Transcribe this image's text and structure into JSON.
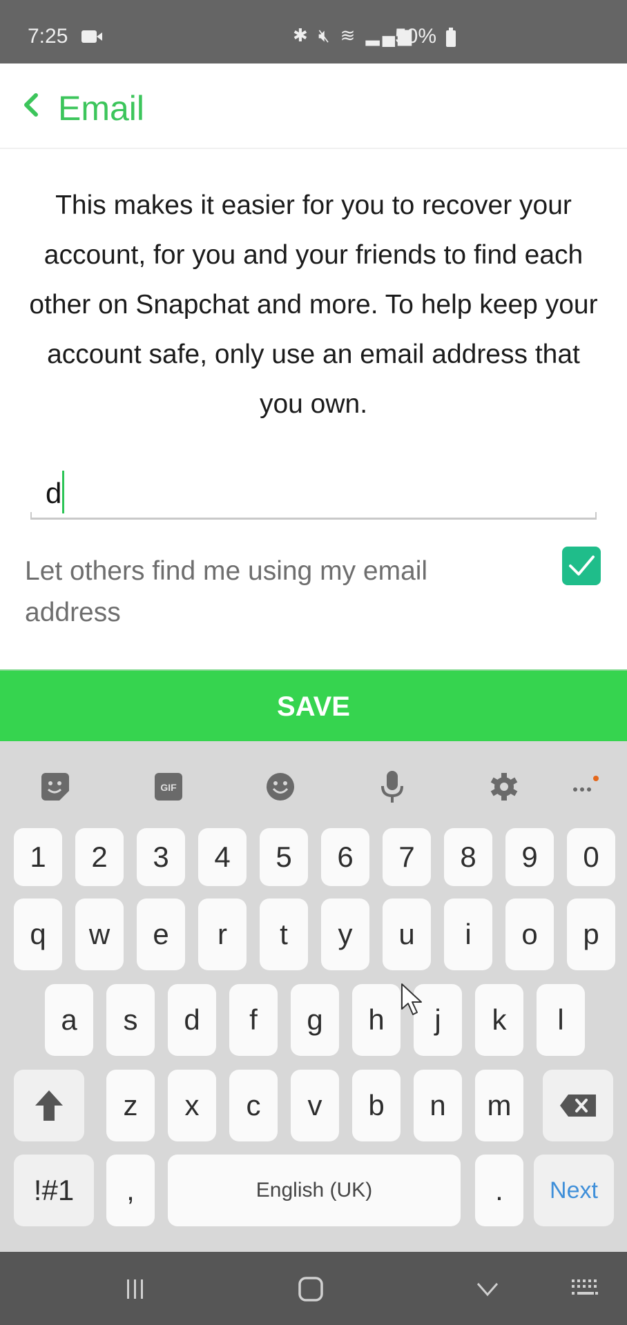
{
  "status_bar": {
    "time": "7:25",
    "icons": [
      "screen-record-icon",
      "bluetooth-icon",
      "mute-icon",
      "wifi-icon",
      "signal-icon"
    ],
    "battery_percent": "50%"
  },
  "header": {
    "back_icon": "chevron-left-icon",
    "title": "Email"
  },
  "description": "This makes it easier for you to recover your account, for you and your friends to find each other on Snapchat and more. To help keep your account safe, only use an email address that you own.",
  "email_field": {
    "value": "d",
    "placeholder": ""
  },
  "find_me_option": {
    "label": "Let others find me using my email address",
    "checked": true
  },
  "save_button": {
    "label": "SAVE"
  },
  "colors": {
    "accent_green": "#3cc55b",
    "save_green": "#36d44f",
    "checkbox_teal": "#1fbd8a",
    "next_blue": "#3f8fd9"
  },
  "keyboard": {
    "toolbar": [
      "sticker-icon",
      "gif-icon",
      "emoji-icon",
      "microphone-icon",
      "settings-icon",
      "more-icon"
    ],
    "gif_label": "GIF",
    "row_numbers": [
      "1",
      "2",
      "3",
      "4",
      "5",
      "6",
      "7",
      "8",
      "9",
      "0"
    ],
    "row_1": [
      "q",
      "w",
      "e",
      "r",
      "t",
      "y",
      "u",
      "i",
      "o",
      "p"
    ],
    "row_2": [
      "a",
      "s",
      "d",
      "f",
      "g",
      "h",
      "j",
      "k",
      "l"
    ],
    "row_3": [
      "z",
      "x",
      "c",
      "v",
      "b",
      "n",
      "m"
    ],
    "symbols_label": "!#1",
    "comma_label": ",",
    "space_label": "English (UK)",
    "period_label": ".",
    "next_label": "Next"
  },
  "nav_bar": {
    "buttons": [
      "recents-icon",
      "home-icon",
      "hide-keyboard-icon",
      "keyboard-switch-icon"
    ]
  }
}
